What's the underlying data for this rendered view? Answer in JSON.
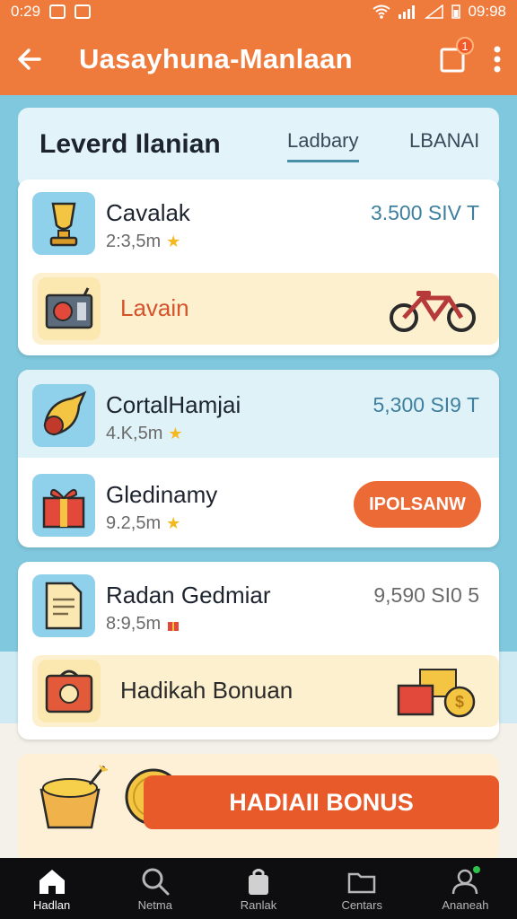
{
  "status_bar": {
    "time": "0:29",
    "clock_right": "09:98"
  },
  "app_bar": {
    "title": "Uasayhuna-Manlaan",
    "notification_count": "1"
  },
  "header": {
    "title": "Leverd Ilanian",
    "tabs": [
      {
        "label": "Ladbary",
        "active": true
      },
      {
        "label": "LBANAI",
        "active": false
      }
    ]
  },
  "items": [
    {
      "name": "Cavalak",
      "sub": "2:3,5m",
      "price": "3.500 SIV T",
      "sub_icon": "star-icon"
    },
    {
      "name": "CortalHamjai",
      "sub": "4.K,5m",
      "price": "5,300 SI9 T",
      "sub_icon": "star-icon"
    },
    {
      "name": "Gledinamy",
      "sub": "9.2,5m",
      "button": "IPOLSANW",
      "sub_icon": "star-icon"
    },
    {
      "name": "Radan Gedmiar",
      "sub": "8:9,5m",
      "price": "9,590 SI0 5",
      "sub_icon": "gift-icon"
    }
  ],
  "bands": {
    "lavain": "Lavain",
    "hadikah": "Hadikah Bonuan"
  },
  "bonus": {
    "label": "HADIAII BONUS"
  },
  "bottom_nav": [
    {
      "label": "Hadlan",
      "icon": "home-icon",
      "active": true
    },
    {
      "label": "Netma",
      "icon": "search-icon",
      "active": false
    },
    {
      "label": "Ranlak",
      "icon": "bag-icon",
      "active": false
    },
    {
      "label": "Centars",
      "icon": "folder-icon",
      "active": false
    },
    {
      "label": "Ananeah",
      "icon": "profile-icon",
      "active": false
    }
  ],
  "colors": {
    "brand": "#ee7a3b",
    "accent_button": "#ec6a36",
    "sky": "#80c8de",
    "price_blue": "#3e7fa0",
    "nav_bg": "#0e0e10"
  }
}
